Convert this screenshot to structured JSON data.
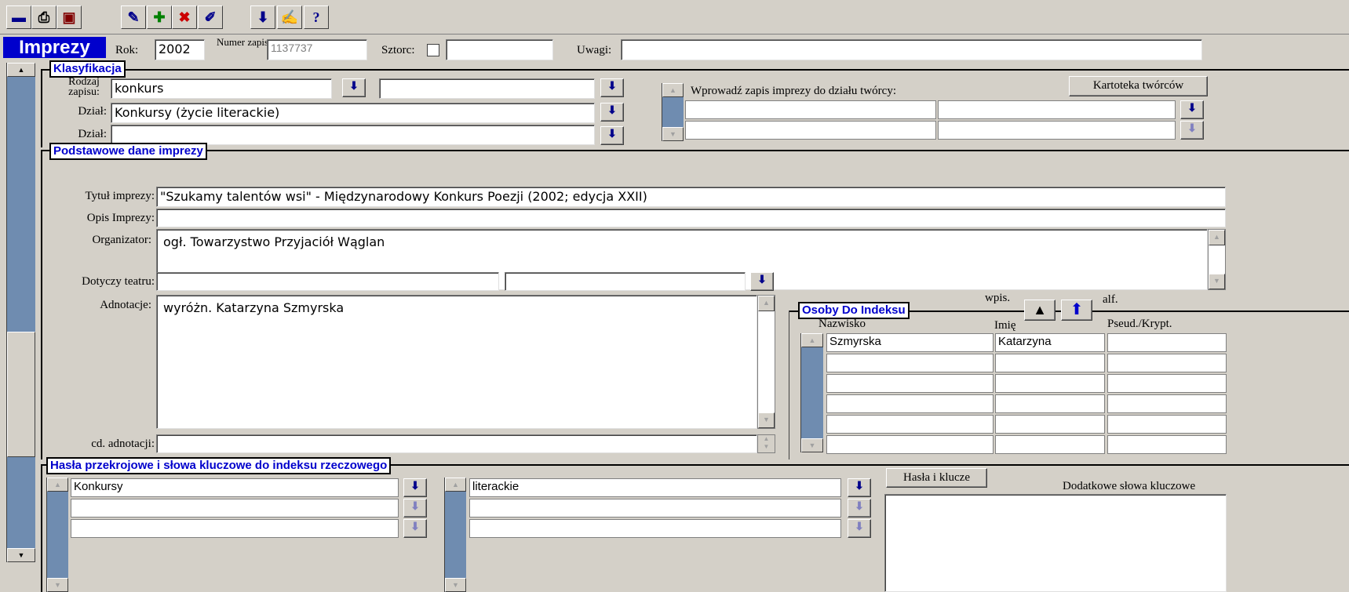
{
  "toolbar": {
    "buttons": [
      {
        "icon": "save-icon",
        "glyph": "▬",
        "color": "#00008b"
      },
      {
        "icon": "print-icon",
        "glyph": "⎙",
        "color": "#000"
      },
      {
        "icon": "preview-icon",
        "glyph": "▣",
        "color": "#800000"
      },
      {
        "icon": "edit-record-icon",
        "glyph": "✎",
        "color": "#00008b"
      },
      {
        "icon": "add-record-icon",
        "glyph": "✚",
        "color": "#008000"
      },
      {
        "icon": "delete-record-icon",
        "glyph": "✖",
        "color": "#cc0000"
      },
      {
        "icon": "undo-edit-icon",
        "glyph": "✐",
        "color": "#00008b"
      },
      {
        "icon": "download-icon",
        "glyph": "⬇",
        "color": "#00008b"
      },
      {
        "icon": "note-icon",
        "glyph": "✍",
        "color": "#00008b"
      },
      {
        "icon": "help-icon",
        "glyph": "?",
        "color": "#00008b"
      }
    ]
  },
  "header": {
    "title": "Imprezy",
    "rok_label": "Rok:",
    "rok_value": "2002",
    "numer_label": "Numer zapisu:",
    "numer_value": "1137737",
    "sztorc_label": "Sztorc:",
    "uwagi_label": "Uwagi:"
  },
  "klasyfikacja": {
    "title": "Klasyfikacja",
    "rodzaj_label": "Rodzaj zapisu:",
    "rodzaj_value": "konkurs",
    "dzial_label": "Dział:",
    "dzial1_value": "Konkursy (życie literackie)",
    "dzial2_label": "Dział:",
    "tworcy_label": "Wprowadź zapis imprezy do działu twórcy:",
    "kartoteka_button": "Kartoteka twórców"
  },
  "podstawowe": {
    "title": "Podstawowe dane imprezy",
    "tytul_label": "Tytuł imprezy:",
    "tytul_value": "\"Szukamy talentów wsi\" - Międzynarodowy Konkurs Poezji (2002; edycja XXII)",
    "opis_label": "Opis Imprezy:",
    "organizator_label": "Organizator:",
    "organizator_value": "ogł. Towarzystwo Przyjaciół Wąglan",
    "dotyczy_label": "Dotyczy teatru:",
    "adnotacje_label": "Adnotacje:",
    "adnotacje_value": "wyróżn. Katarzyna Szmyrska",
    "cd_label": "cd. adnotacji:"
  },
  "osoby": {
    "title": "Osoby Do Indeksu",
    "wpis_label": "wpis.",
    "alf_label": "alf.",
    "col_nazwisko": "Nazwisko",
    "col_imie": "Imię",
    "col_pseud": "Pseud./Krypt.",
    "rows": [
      {
        "nazwisko": "Szmyrska",
        "imie": "Katarzyna",
        "pseud": ""
      }
    ]
  },
  "hasla": {
    "title": "Hasła przekrojowe i słowa kluczowe do indeksu rzeczowego",
    "list1": [
      "Konkursy"
    ],
    "list2": [
      "literackie"
    ],
    "hasla_button": "Hasła i klucze",
    "dodatkowe_label": "Dodatkowe słowa kluczowe"
  }
}
